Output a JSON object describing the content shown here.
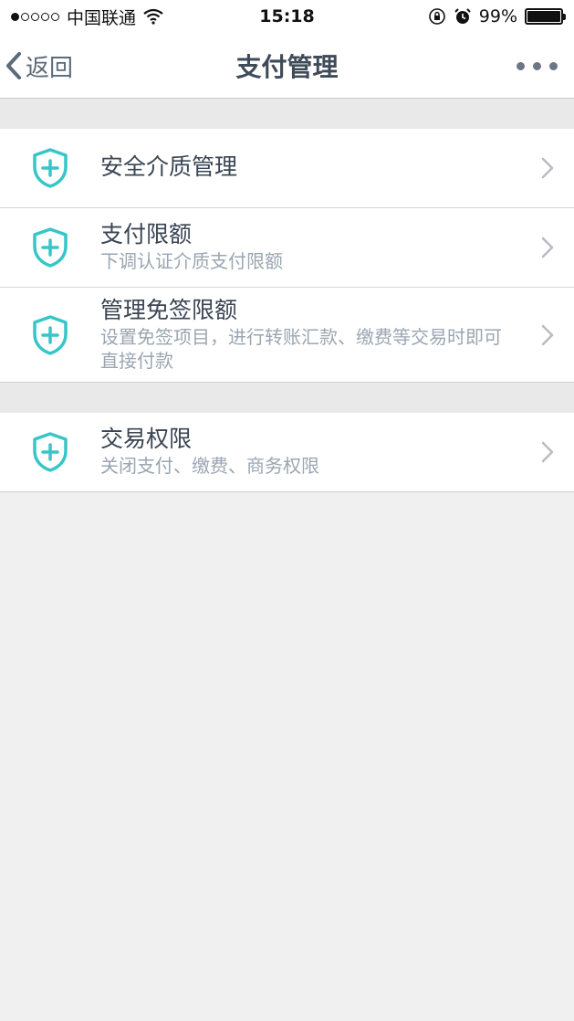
{
  "status_bar": {
    "carrier": "中国联通",
    "time": "15:18",
    "battery": "99%",
    "battery_level": 0.99,
    "signal_strength": 1
  },
  "nav": {
    "back_label": "返回",
    "title": "支付管理"
  },
  "sections": [
    {
      "items": [
        {
          "title": "安全介质管理",
          "subtitle": ""
        },
        {
          "title": "支付限额",
          "subtitle": "下调认证介质支付限额"
        },
        {
          "title": "管理免签限额",
          "subtitle": "设置免签项目，进行转账汇款、缴费等交易时即可直接付款"
        }
      ]
    },
    {
      "items": [
        {
          "title": "交易权限",
          "subtitle": "关闭支付、缴费、商务权限"
        }
      ]
    }
  ],
  "colors": {
    "accent_icon": "#36c6c9",
    "background": "#f0f0f0",
    "section_gap": "#e9e9e9"
  }
}
